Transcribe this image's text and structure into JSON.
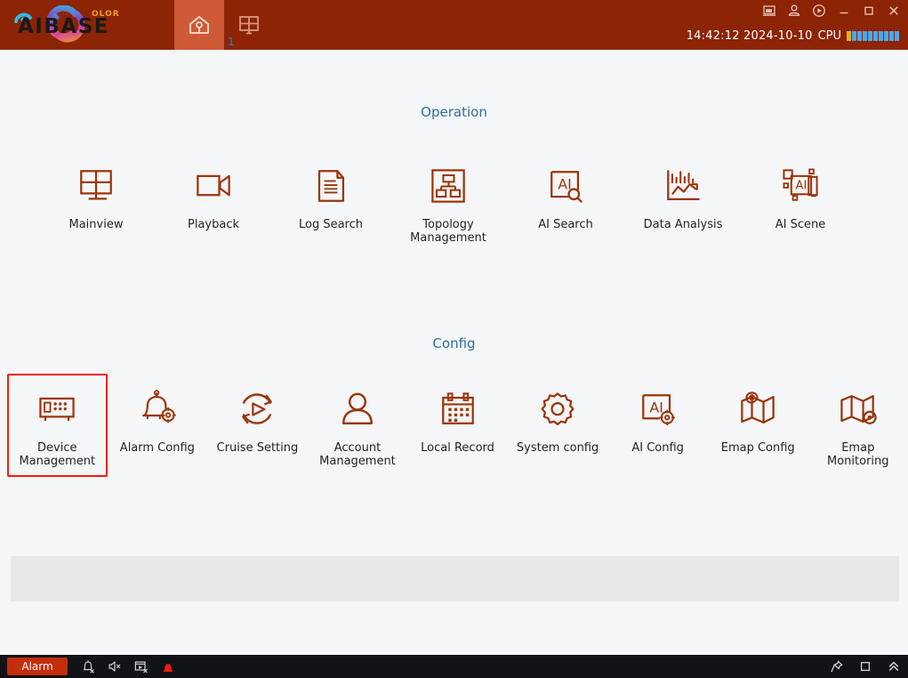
{
  "app": {
    "brand_primary": "AIBASE",
    "brand_suffix": "OLOR",
    "accent_brown": "#8c2405",
    "icon_brown": "#9c3409",
    "heading_blue": "#2d6f9e",
    "select_red": "#f51b05",
    "tab_active_bg": "#cf5a36"
  },
  "topbar": {
    "tabs": [
      {
        "name": "home-tab",
        "icon": "home-icon",
        "active": true,
        "badge": ""
      },
      {
        "name": "layout-tab",
        "icon": "grid-screen-icon",
        "active": false,
        "badge": "1"
      }
    ],
    "window_controls": [
      {
        "name": "screen-icon",
        "title": "Screen"
      },
      {
        "name": "user-icon",
        "title": "User"
      },
      {
        "name": "power-icon",
        "title": "Power"
      },
      {
        "name": "minimize-icon",
        "title": "Minimize"
      },
      {
        "name": "maximize-icon",
        "title": "Maximize"
      },
      {
        "name": "close-icon",
        "title": "Close"
      }
    ],
    "clock": "14:42:12 2024-10-10",
    "cpu_label": "CPU",
    "cpu_segments": 10,
    "cpu_warn_segments": 1
  },
  "sections": [
    {
      "title": "Operation",
      "items": [
        {
          "label": "Mainview",
          "icon": "mainview-icon",
          "selected": false
        },
        {
          "label": "Playback",
          "icon": "playback-icon",
          "selected": false
        },
        {
          "label": "Log Search",
          "icon": "log-search-icon",
          "selected": false
        },
        {
          "label": "Topology Management",
          "icon": "topology-icon",
          "selected": false
        },
        {
          "label": "AI Search",
          "icon": "ai-search-icon",
          "selected": false
        },
        {
          "label": "Data Analysis",
          "icon": "data-analysis-icon",
          "selected": false
        },
        {
          "label": "AI Scene",
          "icon": "ai-scene-icon",
          "selected": false
        }
      ]
    },
    {
      "title": "Config",
      "items": [
        {
          "label": "Device Management",
          "icon": "device-management-icon",
          "selected": true
        },
        {
          "label": "Alarm Config",
          "icon": "alarm-config-icon",
          "selected": false
        },
        {
          "label": "Cruise Setting",
          "icon": "cruise-setting-icon",
          "selected": false
        },
        {
          "label": "Account Management",
          "icon": "account-icon",
          "selected": false
        },
        {
          "label": "Local Record",
          "icon": "calendar-record-icon",
          "selected": false
        },
        {
          "label": "System config",
          "icon": "gear-icon",
          "selected": false
        },
        {
          "label": "AI Config",
          "icon": "ai-config-icon",
          "selected": false
        },
        {
          "label": "Emap Config",
          "icon": "emap-config-icon",
          "selected": false
        },
        {
          "label": "Emap Monitoring",
          "icon": "emap-monitoring-icon",
          "selected": false
        }
      ]
    }
  ],
  "bottombar": {
    "alarm_label": "Alarm",
    "icons": [
      {
        "name": "bell-off-icon"
      },
      {
        "name": "speaker-mute-icon"
      },
      {
        "name": "record-off-icon"
      },
      {
        "name": "alarm-light-icon"
      }
    ],
    "right_icons": [
      {
        "name": "pin-icon"
      },
      {
        "name": "square-icon"
      },
      {
        "name": "chevron-double-up-icon"
      }
    ]
  }
}
